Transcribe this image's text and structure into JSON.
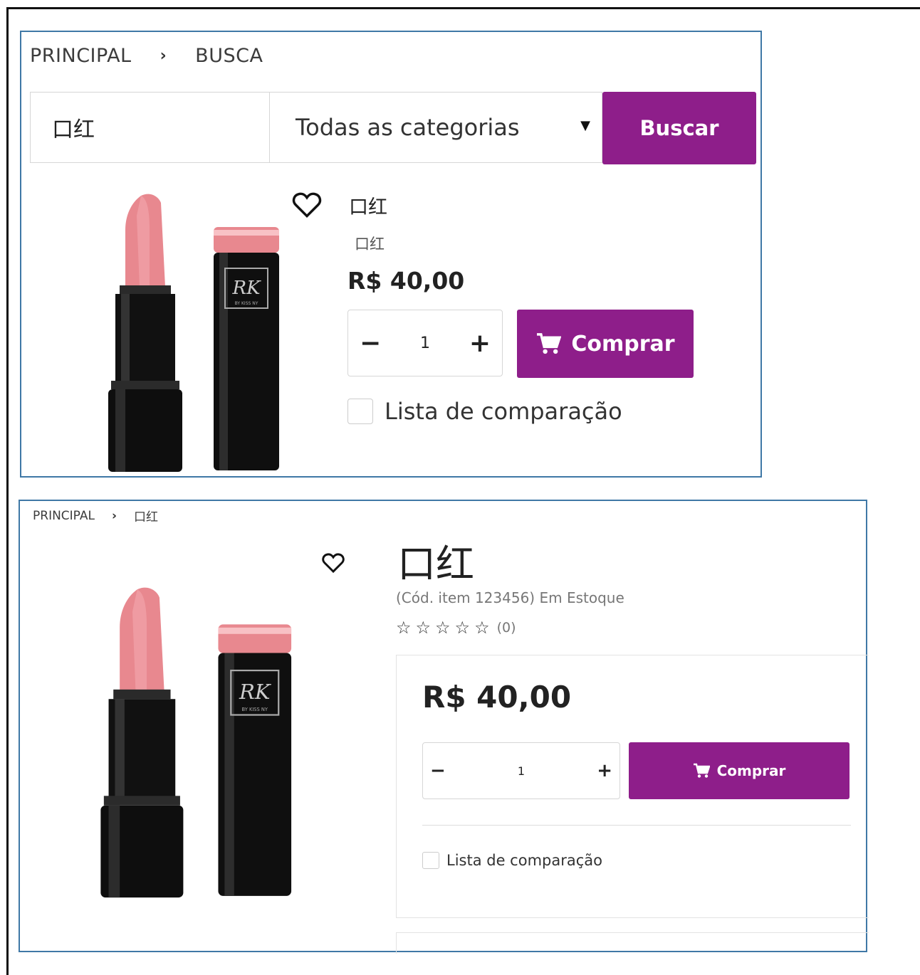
{
  "colors": {
    "accent": "#8e1e8a",
    "panel_border": "#3f78a6"
  },
  "panel1": {
    "breadcrumb": {
      "home": "PRINCIPAL",
      "separator": "›",
      "current": "BUSCA"
    },
    "search": {
      "value": "口红",
      "category": "Todas as categorias",
      "button": "Buscar"
    },
    "product": {
      "favorite_icon": "heart-icon",
      "title": "口红",
      "subtitle": "口红",
      "price": "R$ 40,00",
      "qty": {
        "minus": "−",
        "value": "1",
        "plus": "+"
      },
      "buy_label": "Comprar",
      "buy_icon": "cart-icon",
      "compare_label": "Lista de comparação"
    }
  },
  "panel2": {
    "breadcrumb": {
      "home": "PRINCIPAL",
      "separator": "›",
      "current": "口红"
    },
    "product": {
      "favorite_icon": "heart-icon",
      "title": "口红",
      "code_stock": "(Cód. item 123456) Em Estoque",
      "stars": [
        "☆",
        "☆",
        "☆",
        "☆",
        "☆"
      ],
      "rating_count": "(0)",
      "price": "R$ 40,00",
      "qty": {
        "minus": "−",
        "value": "1",
        "plus": "+"
      },
      "buy_label": "Comprar",
      "buy_icon": "cart-icon",
      "compare_label": "Lista de comparação"
    }
  }
}
